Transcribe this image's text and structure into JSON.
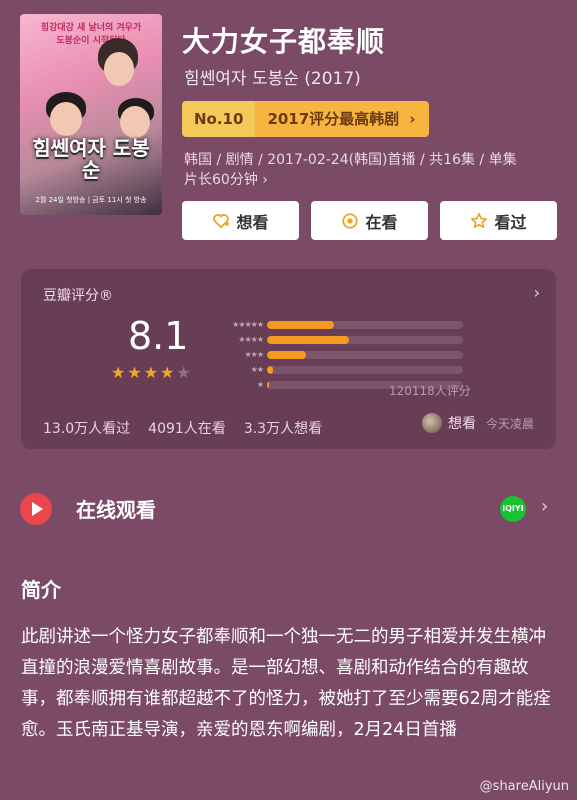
{
  "poster": {
    "tagline": "힘강대강 새 날너의 겨우가 도봉순이 시작된다",
    "title": "힘쎈여자 도봉순",
    "airdate": "2월 24일 첫방송 | 금토 11시 첫 방송"
  },
  "header": {
    "title": "大力女子都奉顺",
    "subtitle": "힘쎈여자 도봉순 (2017)",
    "rank_no": "No.10",
    "rank_label": "2017评分最高韩剧",
    "meta_line1": "韩国 / 剧情 / 2017-02-24(韩国)首播 / 共16集 / 单集",
    "meta_line2": "片长60分钟 ›"
  },
  "actions": {
    "want": "想看",
    "watching": "在看",
    "watched": "看过"
  },
  "rating": {
    "header": "豆瓣评分®",
    "score": "8.1",
    "star_fill": 4,
    "distribution": [
      {
        "stars": "★★★★★",
        "value": 0.34
      },
      {
        "stars": "★★★★",
        "value": 0.42
      },
      {
        "stars": "★★★",
        "value": 0.2
      },
      {
        "stars": "★★",
        "value": 0.03
      },
      {
        "stars": "★",
        "value": 0.01
      }
    ],
    "count": "120118人评分",
    "watched": "13.0万人看过",
    "watching": "4091人在看",
    "want": "3.3万人想看",
    "user_status": "想看",
    "user_time": "今天凌晨"
  },
  "watch": {
    "label": "在线观看",
    "provider": "iQIYI"
  },
  "synopsis": {
    "heading": "简介",
    "text": "此剧讲述一个怪力女子都奉顺和一个独一无二的男子相爱并发生横冲直撞的浪漫爱情喜剧故事。是一部幻想、喜剧和动作结合的有趣故事，都奉顺拥有谁都超越不了的怪力，被她打了至少需要62周才能痊愈。玉氏南正基导演，亲爱的恩东啊编剧，2月24日首播"
  },
  "watermark": "@shareAliyun",
  "colors": {
    "background": "#7a4a67",
    "accent_orange": "#f59b1f",
    "rank_gold": "#f8b441",
    "play_red": "#e9474b",
    "iqiyi_green": "#19c133"
  }
}
